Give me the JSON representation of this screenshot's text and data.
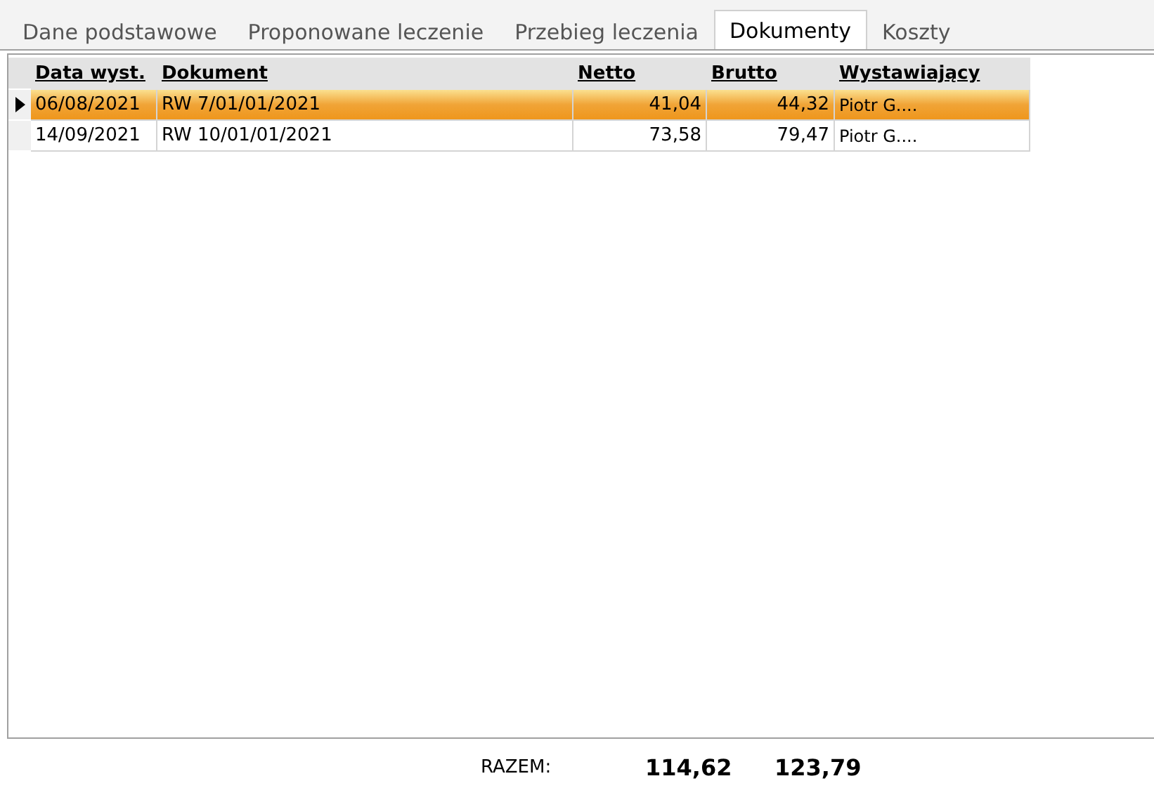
{
  "tabs": [
    {
      "label": "Dane podstawowe",
      "selected": false
    },
    {
      "label": "Proponowane leczenie",
      "selected": false
    },
    {
      "label": "Przebieg leczenia",
      "selected": false
    },
    {
      "label": "Dokumenty",
      "selected": true
    },
    {
      "label": "Koszty",
      "selected": false
    }
  ],
  "table": {
    "columns": [
      {
        "label": "Data wyst.",
        "kind": "text"
      },
      {
        "label": "Dokument",
        "kind": "text"
      },
      {
        "label": "Netto",
        "kind": "amount"
      },
      {
        "label": "Brutto",
        "kind": "amount"
      },
      {
        "label": "Wystawiający",
        "kind": "text"
      }
    ],
    "rows": [
      {
        "selected": true,
        "cells": [
          "06/08/2021",
          "RW 7/01/01/2021",
          "41,04",
          "44,32",
          "Piotr G...."
        ]
      },
      {
        "selected": false,
        "cells": [
          "14/09/2021",
          "RW 10/01/01/2021",
          "73,58",
          "79,47",
          "Piotr G...."
        ]
      }
    ]
  },
  "footer": {
    "label": "RAZEM:",
    "totals": [
      "114,62",
      "123,79"
    ]
  }
}
